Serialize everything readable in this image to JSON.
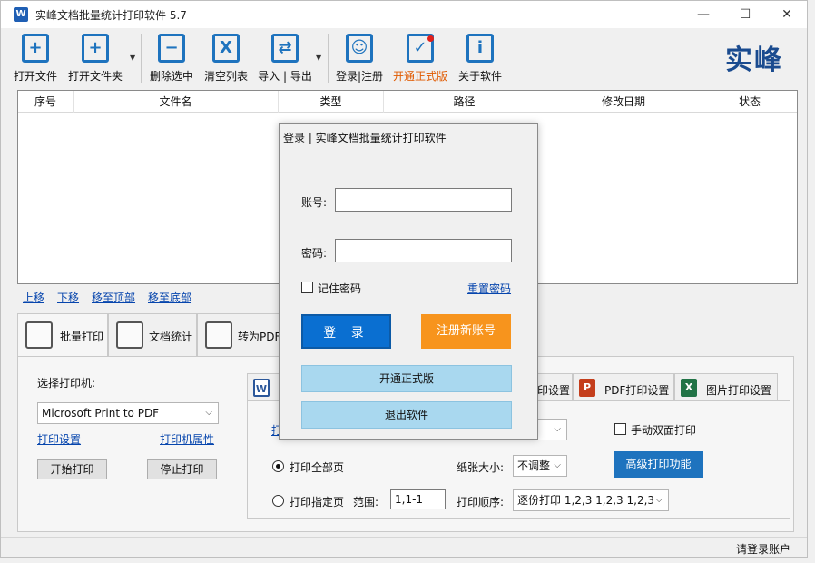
{
  "window": {
    "title": "实峰文档批量统计打印软件 5.7",
    "minimize": "—",
    "maximize": "☐",
    "close": "✕",
    "app_icon": "W"
  },
  "toolbar": {
    "open_file": "打开文件",
    "open_folder": "打开文件夹",
    "delete_selected": "删除选中",
    "clear_list": "清空列表",
    "import_export": "导入 | 导出",
    "login_register": "登录|注册",
    "upgrade": "开通正式版",
    "about": "关于软件",
    "brand": "实峰",
    "upgrade_color": "#e05a00"
  },
  "file_table": {
    "columns": [
      "序号",
      "文件名",
      "类型",
      "路径",
      "修改日期",
      "状态"
    ]
  },
  "move": {
    "up": "上移",
    "down": "下移",
    "top": "移至顶部",
    "bottom": "移至底部"
  },
  "tabs": [
    {
      "label": "批量打印"
    },
    {
      "label": "文档统计"
    },
    {
      "label": "转为PDF"
    }
  ],
  "print_panel": {
    "choose_printer": "选择打印机:",
    "printer_value": "Microsoft Print to PDF",
    "print_settings": "打印设置",
    "printer_props": "打印机属性",
    "start_print": "开始打印",
    "stop_print": "停止打印",
    "word_tab_partial": "印设置",
    "pdf_settings": "PDF打印设置",
    "image_settings": "图片打印设置",
    "print_all": "打印全部页",
    "print_range": "打印指定页",
    "range_label": "范围:",
    "range_value": "1,1-1",
    "paper_size": "纸张大小:",
    "paper_value": "不调整",
    "scale_value": "整",
    "print_order": "打印顺序:",
    "order_value": "逐份打印 1,2,3 1,2,3 1,2,3",
    "manual_duplex": "手动双面打印",
    "advanced": "高级打印功能",
    "partial_label": "打"
  },
  "status": {
    "text": "请登录账户"
  },
  "login_dialog": {
    "title": "登录 | 实峰文档批量统计打印软件",
    "account_label": "账号:",
    "password_label": "密码:",
    "remember": "记住密码",
    "reset": "重置密码",
    "login": "登 录",
    "register": "注册新账号",
    "upgrade": "开通正式版",
    "exit": "退出软件"
  }
}
